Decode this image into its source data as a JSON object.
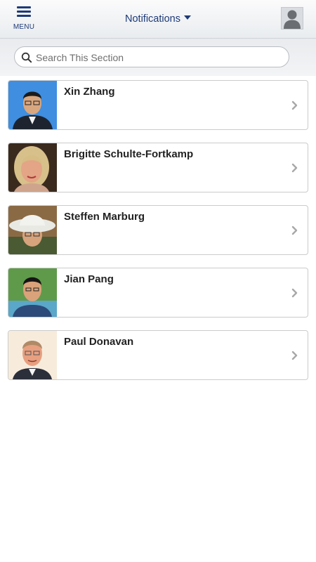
{
  "header": {
    "menu_label": "MENU",
    "title": "Notifications",
    "accent_color": "#1e3a78"
  },
  "search": {
    "placeholder": "Search This Section"
  },
  "people": [
    {
      "name": "Xin Zhang",
      "photo_bg": "#3f8ee0"
    },
    {
      "name": "Brigitte Schulte-Fortkamp",
      "photo_bg": "#3a2a1e"
    },
    {
      "name": "Steffen Marburg",
      "photo_bg": "#8a6a45"
    },
    {
      "name": "Jian Pang",
      "photo_bg": "#5f9a4a"
    },
    {
      "name": "Paul Donavan",
      "photo_bg": "#f7ecdc"
    }
  ]
}
